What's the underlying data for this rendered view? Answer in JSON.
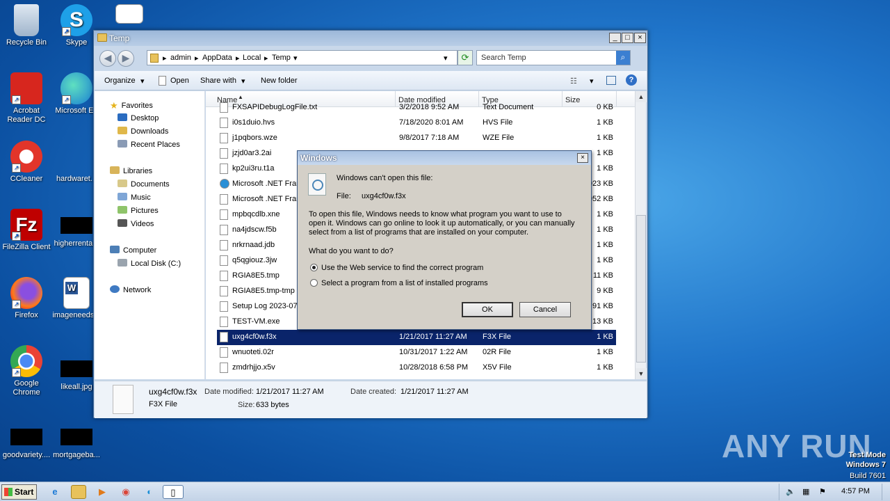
{
  "desktop": {
    "icons": [
      {
        "label": "Recycle Bin"
      },
      {
        "label": "Skype"
      },
      {
        "label": "Acrobat Reader DC"
      },
      {
        "label": "Microsoft Ed"
      },
      {
        "label": "CCleaner"
      },
      {
        "label": "hardwaret..."
      },
      {
        "label": "FileZilla Client"
      },
      {
        "label": "higherrenta..."
      },
      {
        "label": "Firefox"
      },
      {
        "label": "imageneeds..."
      },
      {
        "label": "Google Chrome"
      },
      {
        "label": "likeall.jpg"
      },
      {
        "label": "goodvariety...."
      },
      {
        "label": "mortgageba..."
      }
    ],
    "watermark": "ANY RUN",
    "test_mode": {
      "line1": "Test Mode",
      "line2": "Windows 7",
      "line3": "Build 7601"
    }
  },
  "explorer": {
    "title": "Temp",
    "window_controls": {
      "minimize": "_",
      "maximize": "□",
      "close": "×"
    },
    "breadcrumb": [
      "admin",
      "AppData",
      "Local",
      "Temp"
    ],
    "search_placeholder": "Search Temp",
    "toolbar": {
      "organize": "Organize",
      "open": "Open",
      "share_with": "Share with",
      "new_folder": "New folder"
    },
    "nav": {
      "favorites": "Favorites",
      "desktop": "Desktop",
      "downloads": "Downloads",
      "recent_places": "Recent Places",
      "libraries": "Libraries",
      "documents": "Documents",
      "music": "Music",
      "pictures": "Pictures",
      "videos": "Videos",
      "computer": "Computer",
      "local_disk": "Local Disk (C:)",
      "network": "Network"
    },
    "columns": {
      "name": "Name",
      "date": "Date modified",
      "type": "Type",
      "size": "Size"
    },
    "files": [
      {
        "name": "FXSAPIDebugLogFile.txt",
        "date": "3/2/2018 9:52 AM",
        "type": "Text Document",
        "size": "0 KB"
      },
      {
        "name": "i0s1duio.hvs",
        "date": "7/18/2020 8:01 AM",
        "type": "HVS File",
        "size": "1 KB"
      },
      {
        "name": "j1pqbors.wze",
        "date": "9/8/2017 7:18 AM",
        "type": "WZE File",
        "size": "1 KB"
      },
      {
        "name": "jzjd0ar3.2ai",
        "date": "",
        "type": "",
        "size": "1 KB"
      },
      {
        "name": "kp2ui3ru.t1a",
        "date": "",
        "type": "",
        "size": "1 KB"
      },
      {
        "name": "Microsoft .NET Fran",
        "date": "",
        "type": "",
        "size": "023 KB"
      },
      {
        "name": "Microsoft .NET Fran",
        "date": "",
        "type": "",
        "size": "952 KB"
      },
      {
        "name": "mpbqcdlb.xne",
        "date": "",
        "type": "",
        "size": "1 KB"
      },
      {
        "name": "na4jdscw.f5b",
        "date": "",
        "type": "",
        "size": "1 KB"
      },
      {
        "name": "nrkrnaad.jdb",
        "date": "",
        "type": "",
        "size": "1 KB"
      },
      {
        "name": "q5qgiouz.3jw",
        "date": "",
        "type": "",
        "size": "1 KB"
      },
      {
        "name": "RGIA8E5.tmp",
        "date": "",
        "type": "",
        "size": "11 KB"
      },
      {
        "name": "RGIA8E5.tmp-tmp",
        "date": "",
        "type": "",
        "size": "9 KB"
      },
      {
        "name": "Setup Log 2023-07-",
        "date": "",
        "type": "",
        "size": "91 KB"
      },
      {
        "name": "TEST-VM.exe",
        "date": "",
        "type": "",
        "size": "13 KB"
      },
      {
        "name": "uxg4cf0w.f3x",
        "date": "1/21/2017 11:27 AM",
        "type": "F3X File",
        "size": "1 KB"
      },
      {
        "name": "wnuoteti.02r",
        "date": "10/31/2017 1:22 AM",
        "type": "02R File",
        "size": "1 KB"
      },
      {
        "name": "zmdrhjjo.x5v",
        "date": "10/28/2018 6:58 PM",
        "type": "X5V File",
        "size": "1 KB"
      }
    ],
    "details": {
      "filename": "uxg4cf0w.f3x",
      "filetype": "F3X File",
      "modified_label": "Date modified:",
      "modified": "1/21/2017 11:27 AM",
      "size_label": "Size:",
      "size": "633 bytes",
      "created_label": "Date created:",
      "created": "1/21/2017 11:27 AM"
    }
  },
  "dialog": {
    "title": "Windows",
    "close": "×",
    "heading": "Windows can't open this file:",
    "file_label": "File:",
    "file_name": "uxg4cf0w.f3x",
    "body1": "To open this file, Windows needs to know what program you want to use to",
    "body2": "open it. Windows can go online to look it up automatically, or you can manually",
    "body3": "select from a list of programs that are installed on your computer.",
    "question": "What do you want to do?",
    "option1": "Use the Web service to find the correct program",
    "option2": "Select a program from a list of installed programs",
    "ok": "OK",
    "cancel": "Cancel"
  },
  "taskbar": {
    "start": "Start",
    "time": "4:57 PM"
  }
}
